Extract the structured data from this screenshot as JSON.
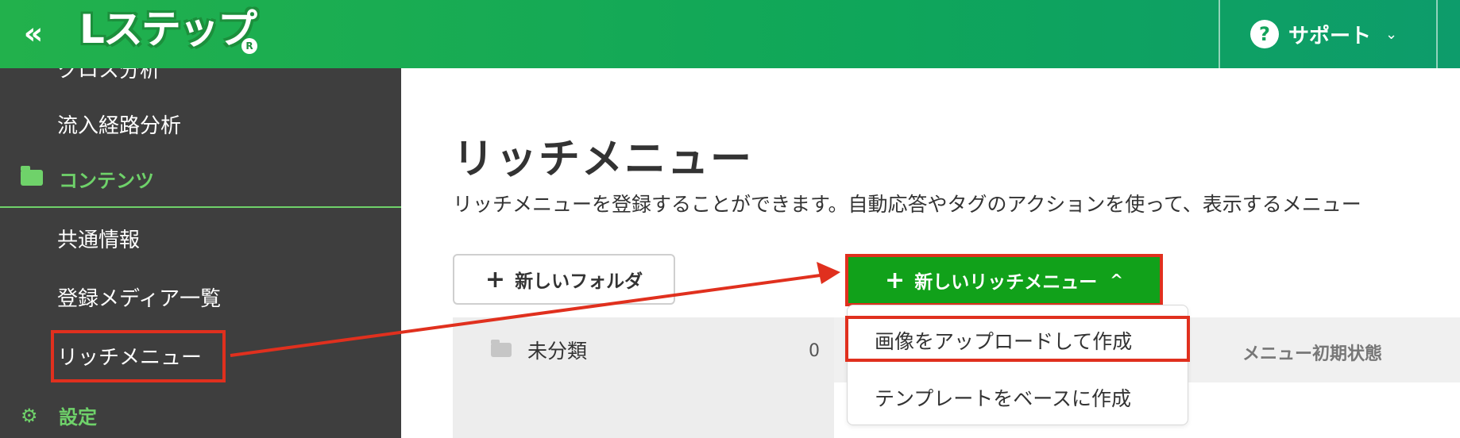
{
  "header": {
    "collapse_icon": "«",
    "logo_text": "Lステップ",
    "logo_mark": "R",
    "support_icon": "?",
    "support_label": "サポート",
    "support_chevron": "⌄"
  },
  "sidebar": {
    "cut_item": "クロス分析",
    "item_inflow": "流入経路分析",
    "section_contents": "コンテンツ",
    "items": [
      "共通情報",
      "登録メディア一覧",
      "リッチメニュー"
    ],
    "section_settings": "設定"
  },
  "main": {
    "title": "リッチメニュー",
    "description": "リッチメニューを登録することができます。自動応答やタグのアクションを使って、表示するメニュー",
    "new_folder_button": "新しいフォルダ",
    "new_richmenu_button": "新しいリッチメニュー",
    "plus_glyph": "+",
    "chevron_up_glyph": "^",
    "folder": {
      "name": "未分類",
      "count": "0"
    },
    "column_header": "メニュー初期状態",
    "dropdown": [
      "画像をアップロードして作成",
      "テンプレートをベースに作成"
    ]
  },
  "colors": {
    "header_green": "#22b14c",
    "sidebar_bg": "#3e3e3e",
    "accent_green": "#6fd26a",
    "button_green": "#11a11a",
    "highlight_red": "#e0301e"
  }
}
